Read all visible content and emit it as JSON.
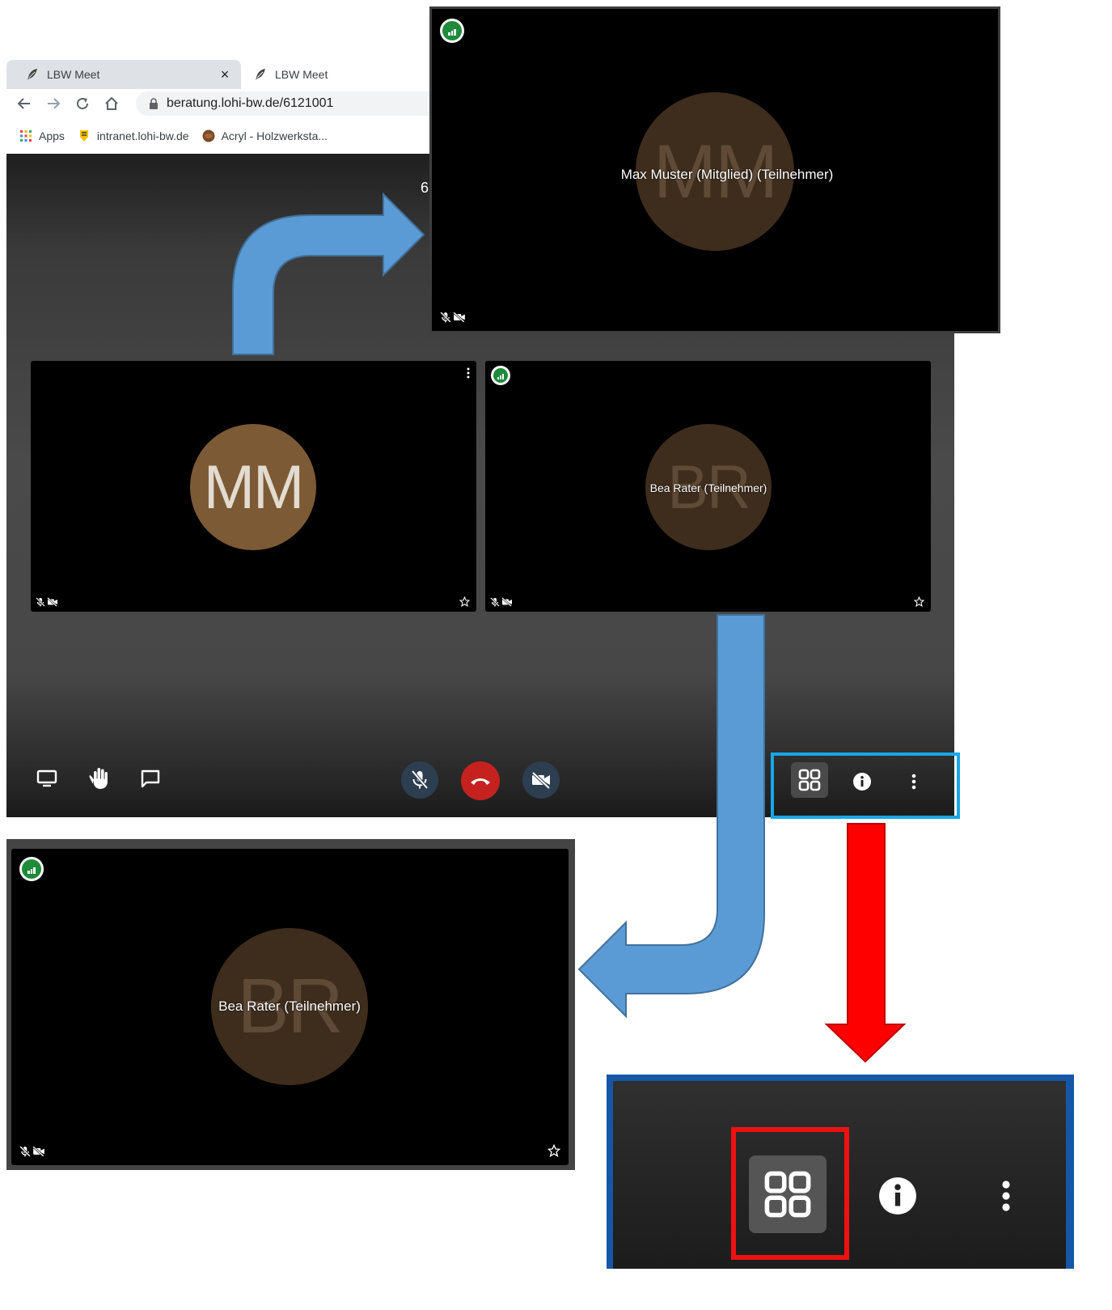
{
  "browser": {
    "tabs": [
      {
        "title": "LBW Meet",
        "active": true
      },
      {
        "title": "LBW Meet",
        "active": false
      }
    ],
    "close_icon": "×",
    "url": "beratung.lohi-bw.de/6121001",
    "bookmarks": [
      {
        "label": "Apps",
        "icon": "apps-grid-icon"
      },
      {
        "label": "intranet.lohi-bw.de",
        "icon": "coat-of-arms-icon"
      },
      {
        "label": "Acryl - Holzwerksta...",
        "icon": "wood-icon"
      }
    ]
  },
  "stage": {
    "header_number": "6",
    "tiles": [
      {
        "initials": "MM",
        "name": "",
        "avatar_color": "#7c5a35"
      },
      {
        "initials": "BR",
        "name": "Bea Rater (Teilnehmer)",
        "avatar_color": "#3e2d1c"
      }
    ],
    "controls_left": [
      "screen-share-icon",
      "raise-hand-icon",
      "chat-icon"
    ],
    "controls_center": [
      "mic-off-icon",
      "hangup-icon",
      "camera-off-icon"
    ],
    "controls_right": [
      "tile-view-icon",
      "info-icon",
      "more-icon"
    ],
    "colors": {
      "hangup": "#c5221f",
      "mute_btn": "#2c3e50"
    }
  },
  "popout": {
    "initials": "MM",
    "name": "Max Muster (Mitglied) (Teilnehmer)",
    "avatar_color": "#3e2d1c"
  },
  "big_tile": {
    "initials": "BR",
    "name": "Bea Rater (Teilnehmer)",
    "avatar_color": "#3e2d1c"
  },
  "annotations": {
    "arrow_colors": {
      "blue": "#5b9bd5",
      "red": "#ff0000"
    },
    "highlight_colors": {
      "cyan": "#19a7e6",
      "dark_blue": "#1556a6",
      "red": "#ee1111"
    }
  }
}
